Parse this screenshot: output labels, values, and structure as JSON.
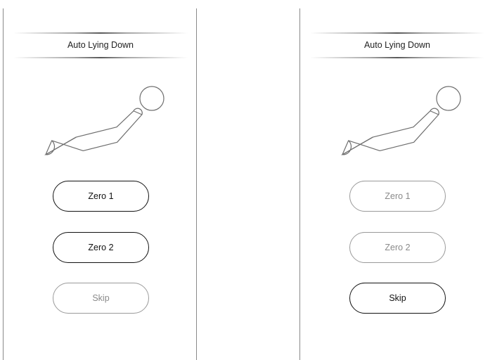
{
  "screens": [
    {
      "title": "Auto Lying Down",
      "buttons": [
        {
          "label": "Zero 1",
          "state": "enabled"
        },
        {
          "label": "Zero 2",
          "state": "enabled"
        },
        {
          "label": "Skip",
          "state": "disabled"
        }
      ]
    },
    {
      "title": "Auto Lying Down",
      "buttons": [
        {
          "label": "Zero 1",
          "state": "disabled"
        },
        {
          "label": "Zero 2",
          "state": "disabled"
        },
        {
          "label": "Skip",
          "state": "enabled"
        }
      ]
    }
  ],
  "icons": {
    "chair": "reclining-chair-icon"
  },
  "colors": {
    "enabled_border": "#111111",
    "disabled_border": "#9a9a9a",
    "disabled_text": "#8a8a8a",
    "icon_stroke": "#6e6e6e"
  }
}
